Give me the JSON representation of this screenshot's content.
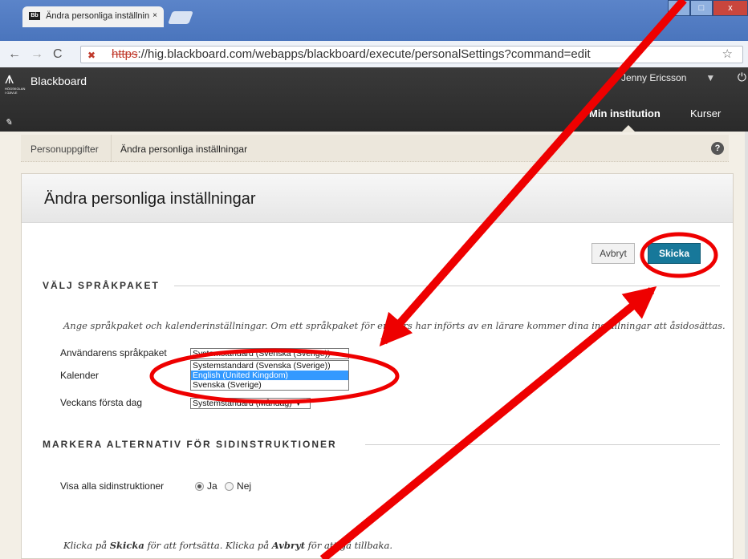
{
  "browser": {
    "tab_title": "Ändra personliga inställnin",
    "tab_favicon": "Bb",
    "tab_close": "×",
    "url_scheme": "https",
    "url_rest": "://hig.blackboard.com/webapps/blackboard/execute/personalSettings?command=edit",
    "window_controls": [
      "–",
      "□",
      "x"
    ]
  },
  "bb": {
    "brand": "Blackboard",
    "logo_text": "HÖGSKOLAN I GÄVLE",
    "user_name": "Jenny Ericsson",
    "tab_institution": "Min institution",
    "tab_courses": "Kurser"
  },
  "breadcrumb": {
    "item1": "Personuppgifter",
    "item2": "Ändra personliga inställningar",
    "help": "?"
  },
  "page": {
    "title": "Ändra personliga inställningar",
    "cancel_label": "Avbryt",
    "submit_label": "Skicka",
    "section1_title": "VÄLJ SPRÅKPAKET",
    "instruction": "Ange språkpaket och kalenderinställningar. Om ett språkpaket för en kurs har införts av en lärare kommer dina inställningar att åsidosättas.",
    "lang_label": "Användarens språkpaket",
    "lang_selected": "Systemstandard (Svenska (Sverige))",
    "lang_options": [
      "Systemstandard (Svenska (Sverige))",
      "English (United Kingdom)",
      "Svenska (Sverige)"
    ],
    "calendar_label": "Kalender",
    "firstday_label": "Veckans första dag",
    "firstday_selected": "Systemstandard (Måndag)",
    "section2_title": "MARKERA ALTERNATIV FÖR SIDINSTRUKTIONER",
    "show_instr_label": "Visa alla sidinstruktioner",
    "radio_yes": "Ja",
    "radio_no": "Nej",
    "footer_pre": "Klicka på ",
    "footer_submit": "Skicka",
    "footer_mid": " för att fortsätta. Klicka på ",
    "footer_cancel": "Avbryt",
    "footer_post": " för att gå tillbaka."
  },
  "colors": {
    "submit_bg": "#17789a",
    "annotation_red": "#ee0000",
    "dropdown_highlight": "#3399ff"
  }
}
